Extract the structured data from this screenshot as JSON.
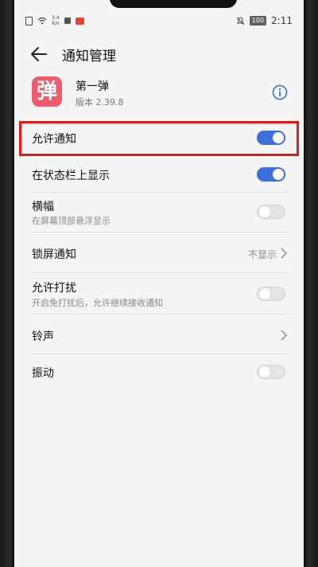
{
  "status_bar": {
    "speed": "3.4\nK/s",
    "battery": "100",
    "time": "2:11"
  },
  "header": {
    "title": "通知管理"
  },
  "app": {
    "icon_char": "弹",
    "icon_color": "#ef5a6e",
    "name": "第一弹",
    "version": "版本 2.39.8"
  },
  "settings": {
    "allow_notifications": {
      "label": "允许通知",
      "enabled": true
    },
    "status_bar_display": {
      "label": "在状态栏上显示",
      "enabled": true
    },
    "banner": {
      "label": "横幅",
      "sub": "在屏幕顶部悬浮显示",
      "enabled": false
    },
    "lock_screen": {
      "label": "锁屏通知",
      "value": "不显示"
    },
    "allow_dnd": {
      "label": "允许打扰",
      "sub": "开启免打扰后，允许继续接收通知",
      "enabled": false
    },
    "ringtone": {
      "label": "铃声"
    },
    "vibration": {
      "label": "振动",
      "enabled": false
    }
  },
  "colors": {
    "accent": "#3d6fdc",
    "highlight": "#e31a1a"
  }
}
